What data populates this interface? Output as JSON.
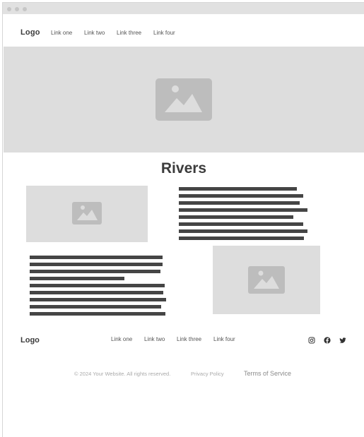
{
  "header": {
    "logo": "Logo",
    "nav_links": [
      "Link one",
      "Link two",
      "Link three",
      "Link four"
    ]
  },
  "hero": {
    "icon": "image-placeholder-icon"
  },
  "main": {
    "title": "Rivers",
    "sections": [
      {
        "image_icon": "image-placeholder-icon"
      },
      {
        "image_icon": "image-placeholder-icon"
      }
    ]
  },
  "footer": {
    "logo": "Logo",
    "nav_links": [
      "Link one",
      "Link two",
      "Link three",
      "Link four"
    ],
    "social_icons": [
      "instagram-icon",
      "facebook-icon",
      "twitter-icon"
    ],
    "copyright": "© 2024 Your Website. All rights reserved.",
    "privacy": "Privacy Policy",
    "terms": "Terms of Service"
  },
  "colors": {
    "placeholder_bg": "#dddddd",
    "placeholder_icon": "#bdbdbd",
    "text_bar": "#454545",
    "titlebar": "#e1e1e1"
  }
}
